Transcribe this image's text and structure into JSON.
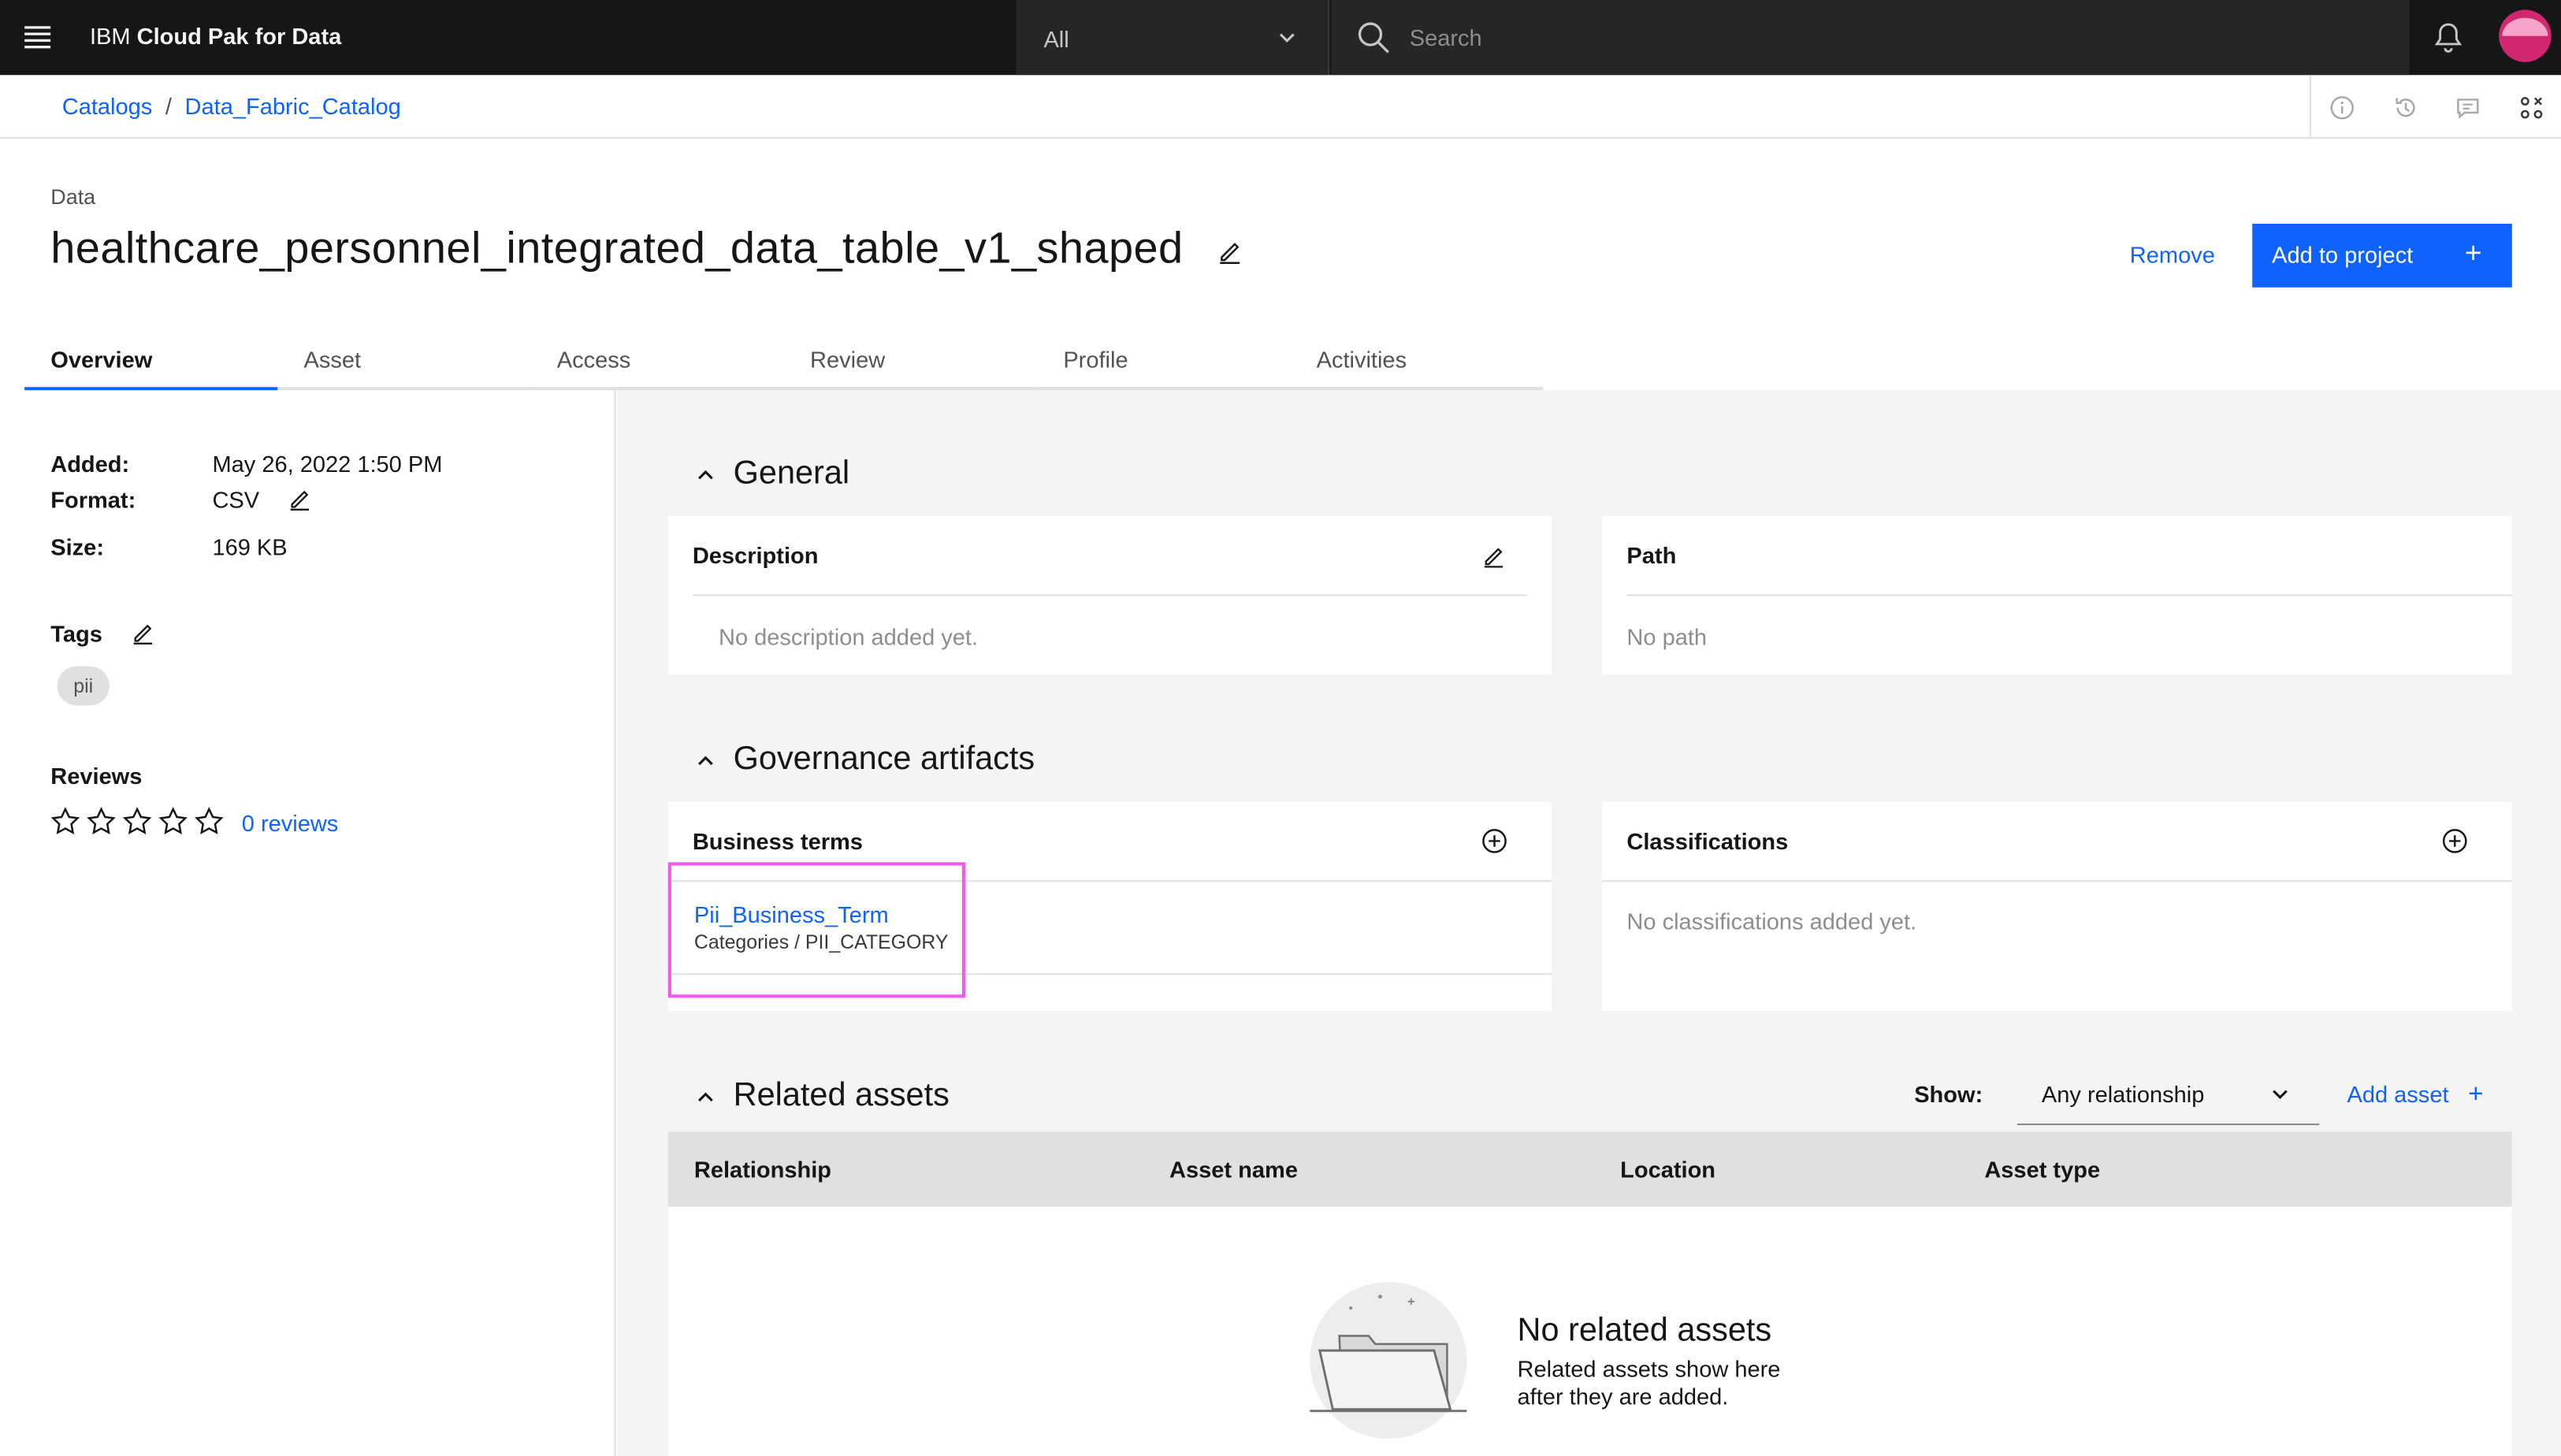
{
  "topbar": {
    "brand_prefix": "IBM",
    "brand_name": "Cloud Pak for Data",
    "scope_selected": "All",
    "search_placeholder": "Search"
  },
  "breadcrumb": {
    "items": [
      "Catalogs",
      "Data_Fabric_Catalog"
    ],
    "separator": "/"
  },
  "header": {
    "type_label": "Data",
    "title": "healthcare_personnel_integrated_data_table_v1_shaped",
    "remove_label": "Remove",
    "add_project_label": "Add to project"
  },
  "tabs": [
    "Overview",
    "Asset",
    "Access",
    "Review",
    "Profile",
    "Activities"
  ],
  "active_tab": "Overview",
  "details": {
    "added_label": "Added:",
    "added_value": "May 26, 2022 1:50 PM",
    "format_label": "Format:",
    "format_value": "CSV",
    "size_label": "Size:",
    "size_value": "169 KB",
    "tags_label": "Tags",
    "tags": [
      "pii"
    ],
    "reviews_label": "Reviews",
    "rating": 0,
    "rating_max": 5,
    "reviews_link": "0 reviews"
  },
  "general": {
    "section_title": "General",
    "description_label": "Description",
    "description_empty": "No description added yet.",
    "path_label": "Path",
    "path_empty": "No path"
  },
  "governance": {
    "section_title": "Governance artifacts",
    "business_terms_label": "Business terms",
    "term_name": "Pii_Business_Term",
    "term_category": "Categories  / PII_CATEGORY",
    "classifications_label": "Classifications",
    "classifications_empty": "No classifications added yet."
  },
  "related": {
    "section_title": "Related assets",
    "show_label": "Show:",
    "relationship_selected": "Any relationship",
    "add_asset_label": "Add asset",
    "columns": [
      "Relationship",
      "Asset name",
      "Location",
      "Asset type"
    ],
    "empty_title": "No related assets",
    "empty_body": "Related assets show here\nafter they are added."
  },
  "colors": {
    "primary": "#0f62fe",
    "topbar_bg": "#161616",
    "highlight_border": "#ee5beb",
    "avatar": "#d12771"
  }
}
